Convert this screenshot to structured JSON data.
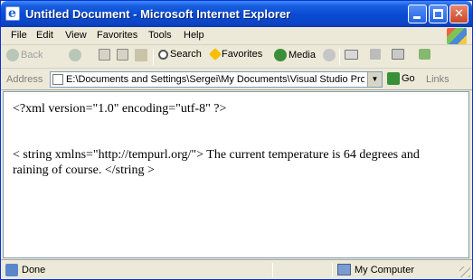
{
  "window": {
    "title": "Untitled Document - Microsoft Internet Explorer",
    "controls": {
      "minimize": "_",
      "maximize": "□",
      "close": "✕"
    }
  },
  "menu": {
    "items": [
      "File",
      "Edit",
      "View",
      "Favorites",
      "Tools",
      "Help"
    ]
  },
  "toolbar": {
    "back_label": "Back",
    "search_label": "Search",
    "favorites_label": "Favorites",
    "media_label": "Media"
  },
  "address": {
    "label": "Address",
    "value": "E:\\Documents and Settings\\Sergei\\My Documents\\Visual Studio Pro",
    "go_label": "Go",
    "links_label": "Links"
  },
  "content": {
    "lines": [
      "<?xml version=\"1.0\" encoding=\"utf-8\" ?>",
      "< string xmlns=\"http://tempurl.org/\"> The current temperature is 64 degrees and raining of course.   </string >"
    ]
  },
  "status": {
    "text": "Done",
    "zone": "My Computer"
  },
  "colors": {
    "titlebar": "#0a4cd6",
    "close_button": "#c9472a",
    "chrome": "#ece9d8"
  }
}
